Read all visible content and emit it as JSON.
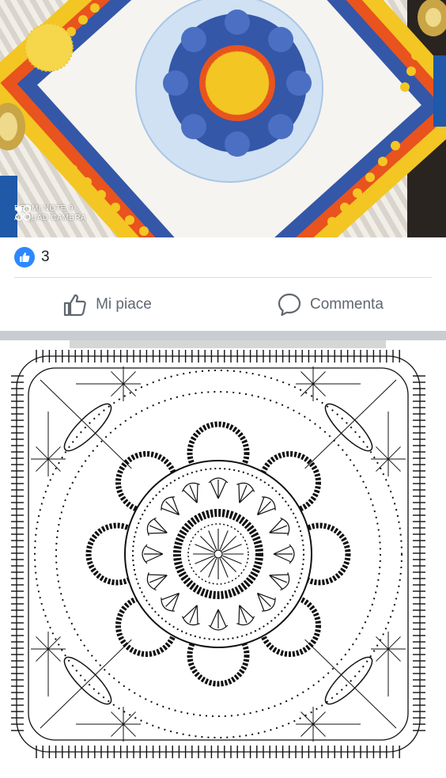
{
  "photo": {
    "watermark_line1": "REDMI NOTE 9",
    "watermark_line2": "AI QUAD CAMERA",
    "colors": {
      "yellow": "#f3c623",
      "orange": "#e9531e",
      "blue": "#3457a8",
      "light_blue": "#cfe1f3",
      "white": "#f5f5f5"
    }
  },
  "reactions": {
    "count": "3",
    "icon": "like-icon"
  },
  "actions": {
    "like_label": "Mi piace",
    "comment_label": "Commenta"
  },
  "diagram": {
    "icon": "crochet-pattern-diagram"
  }
}
